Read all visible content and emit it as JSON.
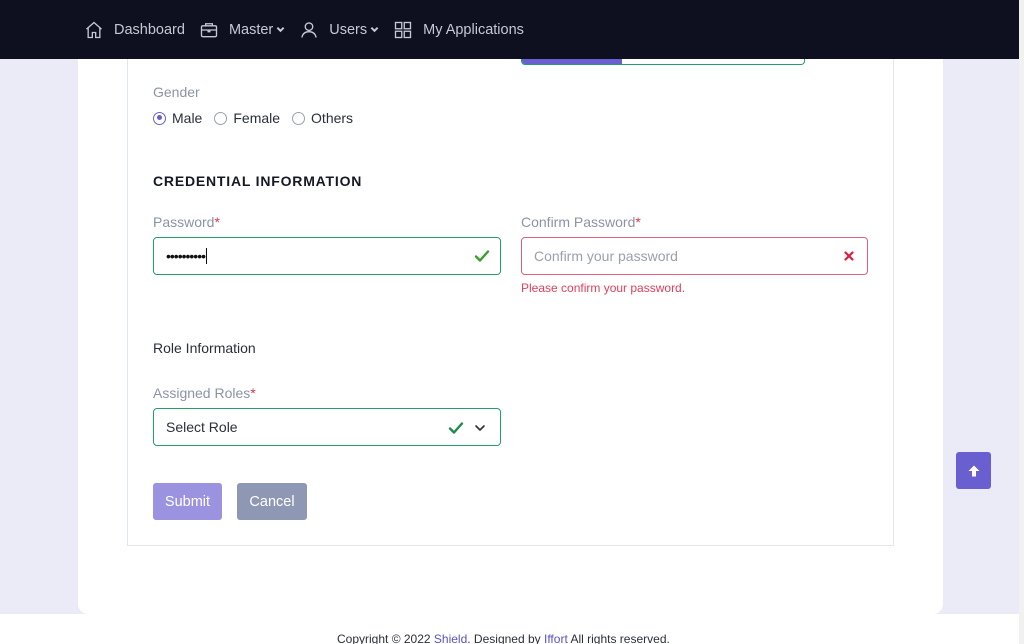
{
  "nav": {
    "items": [
      {
        "label": "Dashboard",
        "icon": "home-icon"
      },
      {
        "label": "Master",
        "icon": "briefcase-icon",
        "has_dropdown": true
      },
      {
        "label": "Users",
        "icon": "user-icon",
        "has_dropdown": true
      },
      {
        "label": "My Applications",
        "icon": "grid-icon"
      }
    ]
  },
  "gender": {
    "label": "Gender",
    "options": [
      "Male",
      "Female",
      "Others"
    ],
    "selected": "Male"
  },
  "credential": {
    "title": "CREDENTIAL INFORMATION",
    "password": {
      "label": "Password",
      "required_mark": "*",
      "value": "••••••••••"
    },
    "confirm_password": {
      "label": "Confirm Password",
      "required_mark": "*",
      "placeholder": "Confirm your password",
      "error": "Please confirm your password."
    }
  },
  "role": {
    "title": "Role Information",
    "assigned_roles": {
      "label": "Assigned Roles",
      "required_mark": "*",
      "value": "Select Role"
    }
  },
  "buttons": {
    "submit": "Submit",
    "cancel": "Cancel"
  },
  "footer": {
    "prefix": "Copyright © 2022 ",
    "brand": "Shield",
    "middle": ". Designed by ",
    "designer": "Iffort",
    "suffix": " All rights reserved."
  },
  "colors": {
    "accent": "#6a5fd0",
    "valid": "#22a06b",
    "error": "#e0405a",
    "nav_bg": "#0e0f1f"
  }
}
